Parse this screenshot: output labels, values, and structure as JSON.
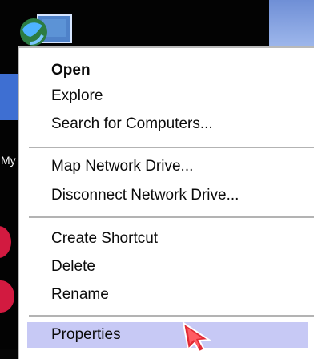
{
  "desktop": {
    "left_label": "My"
  },
  "context_menu": {
    "items": [
      {
        "label": "Open"
      },
      {
        "label": "Explore"
      },
      {
        "label": "Search for Computers..."
      },
      {
        "label": "Map Network Drive..."
      },
      {
        "label": "Disconnect Network Drive..."
      },
      {
        "label": "Create Shortcut"
      },
      {
        "label": "Delete"
      },
      {
        "label": "Rename"
      },
      {
        "label": "Properties"
      }
    ],
    "highlighted_item": "Properties"
  },
  "icons": {
    "desktop_icon": "network-places-icon",
    "pointer": "mouse-pointer-icon"
  },
  "colors": {
    "menu_background": "#ffffff",
    "highlight": "#c7c9f5",
    "separator": "#b3b3b3",
    "pointer_red": "#e12a34"
  }
}
